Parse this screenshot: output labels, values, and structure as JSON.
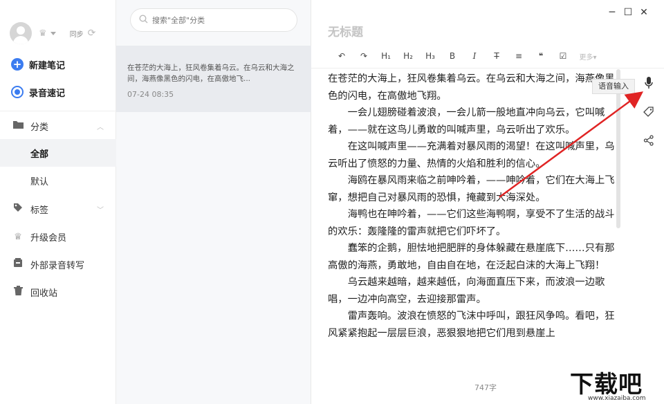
{
  "sidebar": {
    "sync_label": "同步",
    "quick_actions": [
      {
        "label": "新建笔记"
      },
      {
        "label": "录音速记"
      }
    ],
    "nav": {
      "category": "分类",
      "all": "全部",
      "default": "默认",
      "tags": "标签",
      "upgrade": "升级会员",
      "transcribe": "外部录音转写",
      "trash": "回收站"
    }
  },
  "list": {
    "search_placeholder": "搜索\"全部\"分类",
    "notes": [
      {
        "preview": "在苍茫的大海上，狂风卷集着乌云。在乌云和大海之间，海燕像黑色的闪电，在高傲地飞...",
        "date": "07-24 08:35"
      }
    ]
  },
  "editor": {
    "title": "无标题",
    "toolbar": {
      "undo": "↶",
      "redo": "↷",
      "h1": "H₁",
      "h2": "H₂",
      "h3": "H₃",
      "bold": "B",
      "italic": "I",
      "strike": "T",
      "align": "≡",
      "quote": "❝",
      "check": "☑",
      "more": "更多▾"
    },
    "paragraphs": [
      {
        "indent": false,
        "text": "在苍茫的大海上，狂风卷集着乌云。在乌云和大海之间，海燕像黑色的闪电，在高傲地飞翔。"
      },
      {
        "indent": true,
        "text": "一会儿翅膀碰着波浪，一会儿箭一般地直冲向乌云，它叫喊着，——就在这鸟儿勇敢的叫喊声里，乌云听出了欢乐。"
      },
      {
        "indent": true,
        "text": "在这叫喊声里——充满着对暴风雨的渴望！在这叫喊声里，乌云听出了愤怒的力量、热情的火焰和胜利的信心。"
      },
      {
        "indent": true,
        "text": "海鸥在暴风雨来临之前呻吟着，——呻吟着，它们在大海上飞窜，想把自己对暴风雨的恐惧，掩藏到大海深处。"
      },
      {
        "indent": true,
        "text": "海鸭也在呻吟着，——它们这些海鸭啊，享受不了生活的战斗的欢乐：轰隆隆的雷声就把它们吓坏了。"
      },
      {
        "indent": true,
        "text": "蠢笨的企鹅，胆怯地把肥胖的身体躲藏在悬崖底下……只有那高傲的海燕，勇敢地，自由自在地，在泛起白沫的大海上飞翔！"
      },
      {
        "indent": true,
        "text": "乌云越来越暗，越来越低，向海面直压下来，而波浪一边歌唱，一边冲向高空，去迎接那雷声。"
      },
      {
        "indent": true,
        "text": "雷声轰响。波浪在愤怒的飞沫中呼叫，跟狂风争鸣。看吧，狂风紧紧抱起一层层巨浪，恶狠狠地把它们甩到悬崖上"
      }
    ],
    "tooltip": "语音输入",
    "word_count": "747字"
  },
  "watermark": {
    "logo": "下载吧",
    "url": "www.xiazaiba.com"
  },
  "colors": {
    "accent": "#3b7cf0",
    "arrow": "#e02424"
  }
}
